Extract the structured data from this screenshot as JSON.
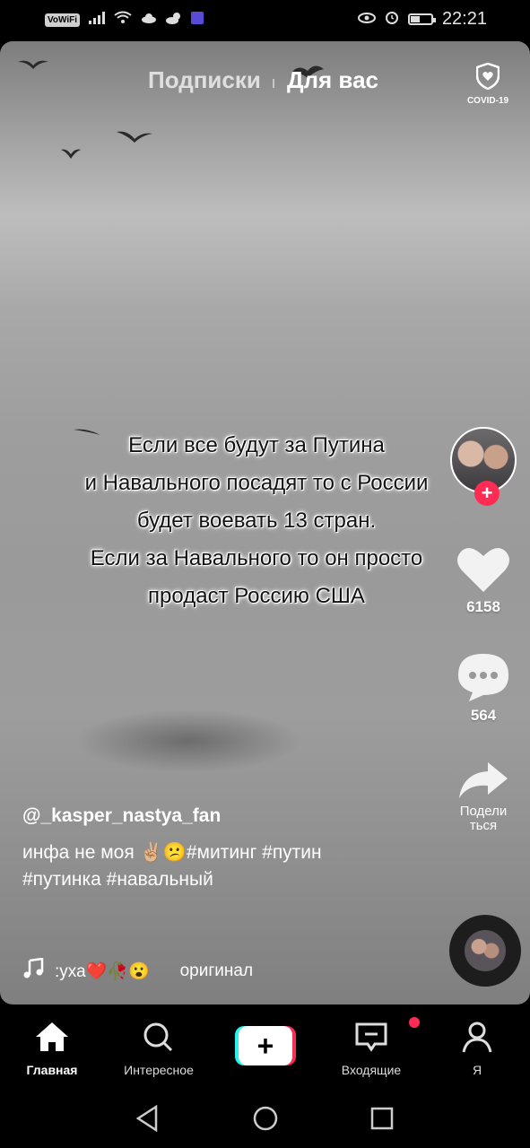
{
  "status_bar": {
    "left_badge": "VoWiFi",
    "time": "22:21",
    "battery_percent": 45
  },
  "top_nav": {
    "tabs": [
      {
        "label": "Подписки",
        "active": false
      },
      {
        "label": "Для вас",
        "active": true
      }
    ],
    "covid_label": "COVID-19"
  },
  "video": {
    "overlay_lines": [
      "Если все будут за Путина",
      "и Навального посадят то с России",
      "будет воевать 13 стран.",
      "Если за Навального то он просто",
      "продаст Россию США"
    ]
  },
  "actions": {
    "likes": "6158",
    "comments": "564",
    "share_label_1": "Подели",
    "share_label_2": "ться"
  },
  "caption": {
    "username": "@_kasper_nastya_fan",
    "line1": "инфа не моя ✌🏼😕#митинг #путин",
    "line2": "#путинка #навальный"
  },
  "music": {
    "text": ":уха❤️🥀😮",
    "original": "оригинал"
  },
  "bottom_nav": {
    "items": [
      {
        "label": "Главная",
        "icon": "home-icon",
        "active": true
      },
      {
        "label": "Интересное",
        "icon": "search-icon",
        "active": false
      },
      {
        "label": "+",
        "icon": "create-icon",
        "active": false
      },
      {
        "label": "Входящие",
        "icon": "inbox-icon",
        "active": false
      },
      {
        "label": "Я",
        "icon": "profile-icon",
        "active": false
      }
    ]
  },
  "colors": {
    "accent": "#fe2c55",
    "cyan": "#25f4ee"
  }
}
